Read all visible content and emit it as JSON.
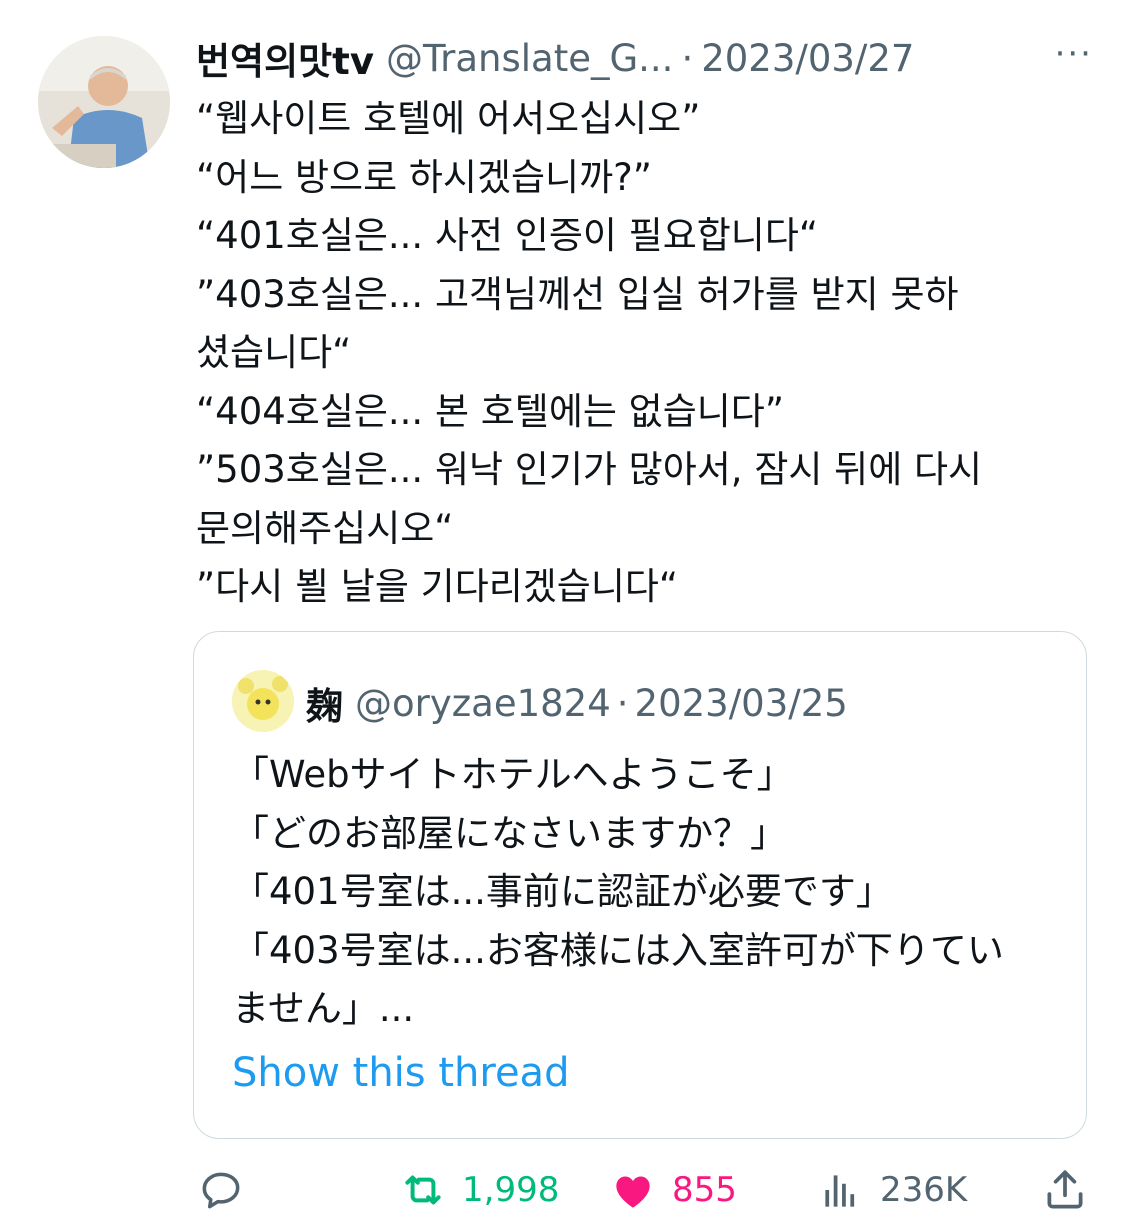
{
  "tweet": {
    "display_name": "번역의맛tv",
    "handle": "@Translate_G...",
    "separator": "·",
    "date": "2023/03/27",
    "more": "···",
    "lines": [
      "“웹사이트 호텔에 어서오십시오”",
      "“어느 방으로 하시겠습니까?”",
      "“401호실은... 사전 인증이 필요합니다“",
      "”403호실은... 고객님께선 입실 허가를 받지 못하",
      "셨습니다“",
      "“404호실은... 본 호텔에는 없습니다”",
      "”503호실은... 워낙 인기가 많아서, 잠시 뒤에 다시",
      "문의해주십시오“",
      "”다시 뵐 날을 기다리겠습니다“"
    ]
  },
  "quote": {
    "display_name": "麹",
    "handle": "@oryzae1824",
    "separator": "·",
    "date": "2023/03/25",
    "lines": [
      "「Webサイトホテルへようこそ」",
      "「どのお部屋になさいますか？」",
      "「401号室は...事前に認証が必要です」",
      "「403号室は...お客様には入室許可が下りてい",
      "ません」..."
    ],
    "show_thread": "Show this thread"
  },
  "actions": {
    "reply_icon": "reply-icon",
    "retweet_icon": "retweet-icon",
    "retweets": "1,998",
    "like_icon": "heart-icon",
    "likes": "855",
    "views_icon": "views-icon",
    "views": "236K",
    "share_icon": "share-icon"
  },
  "colors": {
    "retweeted": "#00ba7c",
    "liked": "#f91880",
    "link": "#1d9bf0",
    "secondary": "#536471"
  }
}
